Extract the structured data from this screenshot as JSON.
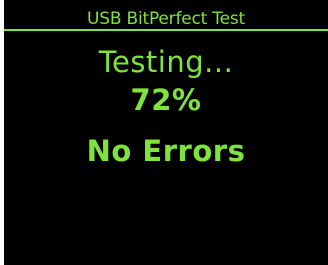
{
  "header": {
    "title": "USB BitPerfect Test"
  },
  "test": {
    "status_text": "Testing...",
    "progress_text": "72%",
    "progress_value": 72,
    "result_text": "No Errors"
  },
  "colors": {
    "background": "#000000",
    "text": "#7ee33a"
  }
}
